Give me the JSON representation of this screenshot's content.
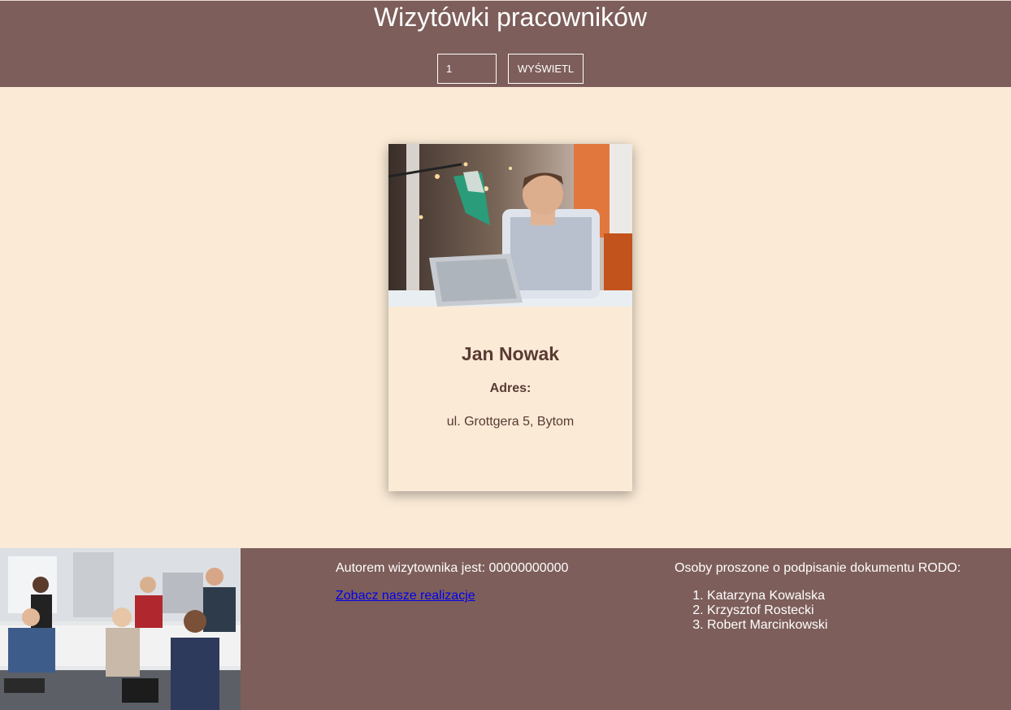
{
  "header": {
    "title": "Wizytówki pracowników",
    "id_input_value": "1",
    "show_button_label": "WYŚWIETL"
  },
  "card": {
    "photo_icon": "employee-photo",
    "name": "Jan Nowak",
    "address_label": "Adres:",
    "address_value": "ul. Grottgera 5, Bytom"
  },
  "footer": {
    "team_photo_icon": "team-photo",
    "author_text": "Autorem wizytownika jest: 00000000000",
    "link_text": "Zobacz nasze realizacje",
    "rodo_heading": "Osoby proszone o podpisanie dokumentu RODO:",
    "rodo_people": [
      "Katarzyna Kowalska",
      "Krzysztof Rostecki",
      "Robert Marcinkowski"
    ]
  },
  "colors": {
    "header_bg": "#7d5e5a",
    "page_bg": "#faead6",
    "text_dark": "#5a3a33",
    "link": "#0000ee"
  }
}
